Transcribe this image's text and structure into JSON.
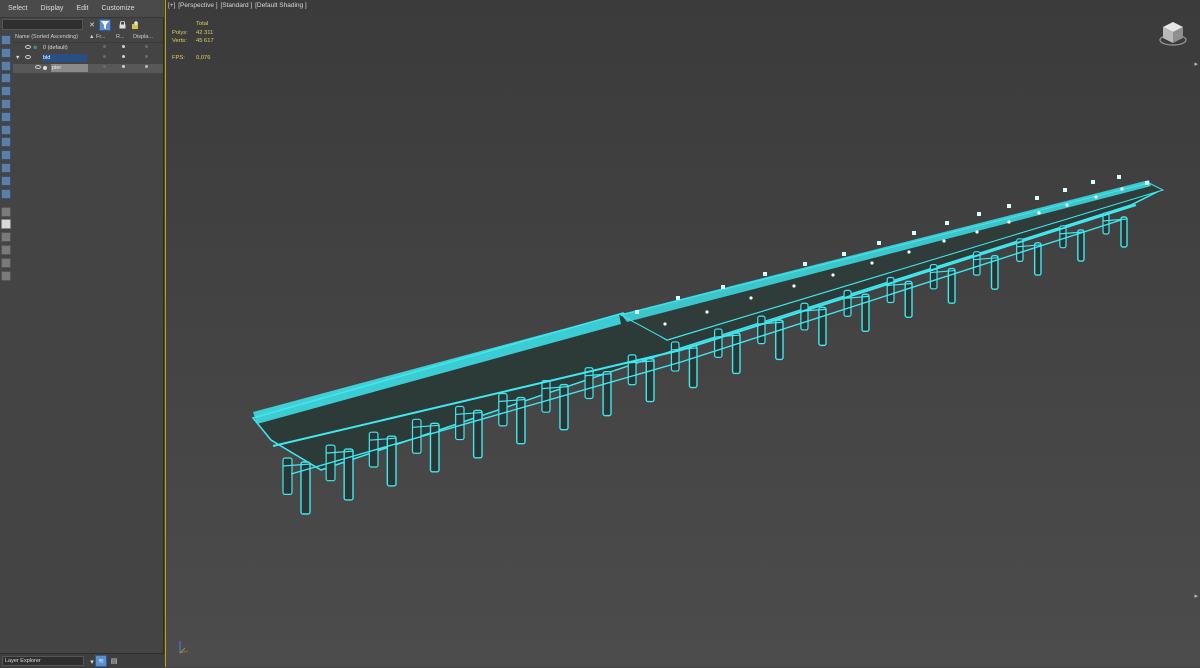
{
  "menu": {
    "items": [
      "Select",
      "Display",
      "Edit",
      "Customize"
    ]
  },
  "toolbar": {
    "search_value": "",
    "icons": [
      "close-icon",
      "filter-icon",
      "lock-icon",
      "add-layer-icon"
    ]
  },
  "explorer": {
    "columns": {
      "name": "Name (Sorted Ascending)",
      "frozen": "▲ Fr...",
      "render": "R...",
      "display": "Displa..."
    },
    "layers": [
      {
        "label": "0 (default)",
        "level": 0,
        "selected": false
      },
      {
        "label": "bld",
        "level": 0,
        "selected": true
      },
      {
        "label": "pier",
        "level": 1,
        "selected": false
      }
    ]
  },
  "bottom": {
    "layer_selector": "Layer Explorer"
  },
  "viewport": {
    "label_plus": "[+]",
    "label_view": "[Perspective ]",
    "label_mode": "[Standard ]",
    "label_shading": "[Default Shading ]",
    "stats_total": "Total",
    "stats": [
      {
        "label": "Polys:",
        "value": "42 311"
      },
      {
        "label": "Verts:",
        "value": "45 617"
      }
    ],
    "fps_label": "FPS:",
    "fps_value": "0,076",
    "wire_color": "#3fe8f0",
    "deck_color": "#2c3a38"
  }
}
